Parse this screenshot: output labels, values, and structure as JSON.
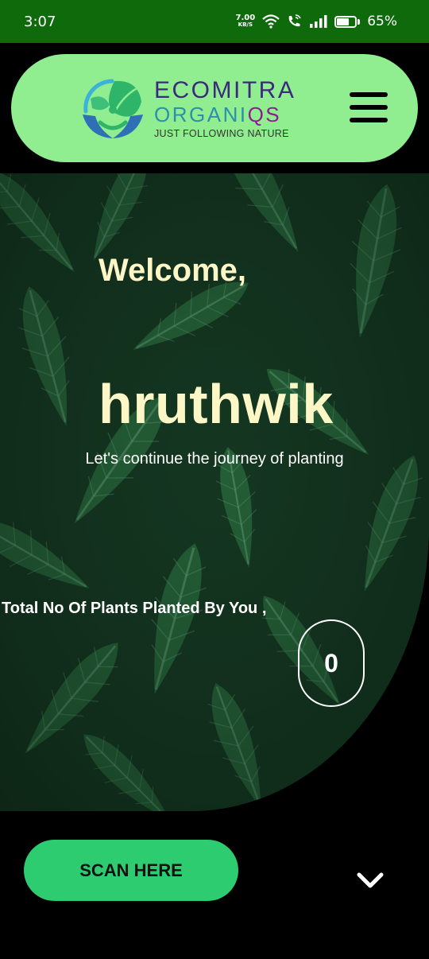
{
  "status_bar": {
    "time": "3:07",
    "net_speed_value": "7.00",
    "net_speed_unit": "KB/S",
    "battery": "65%",
    "battery_level": 0.65,
    "icons": [
      "wifi-icon",
      "wifi-call-icon",
      "signal-icon",
      "battery-icon"
    ]
  },
  "header": {
    "logo_line1": "ECOMITRA",
    "logo_line2_a": "ORGANI",
    "logo_line2_b": "QS",
    "logo_line3": "JUST FOLLOWING NATURE",
    "menu_icon": "hamburger-menu-icon"
  },
  "hero": {
    "welcome": "Welcome,",
    "username": "hruthwik",
    "tagline": "Let's continue the journey of planting",
    "plants_label": "Total No Of Plants Planted By You ,",
    "plants_count": "0"
  },
  "actions": {
    "scan_label": "SCAN HERE",
    "chevron_icon": "chevron-down-icon"
  },
  "colors": {
    "status_bar": "#0f6a0c",
    "header_bg": "#90ee90",
    "hero_text": "#fdf6c6",
    "scan_button": "#2ecc71"
  }
}
